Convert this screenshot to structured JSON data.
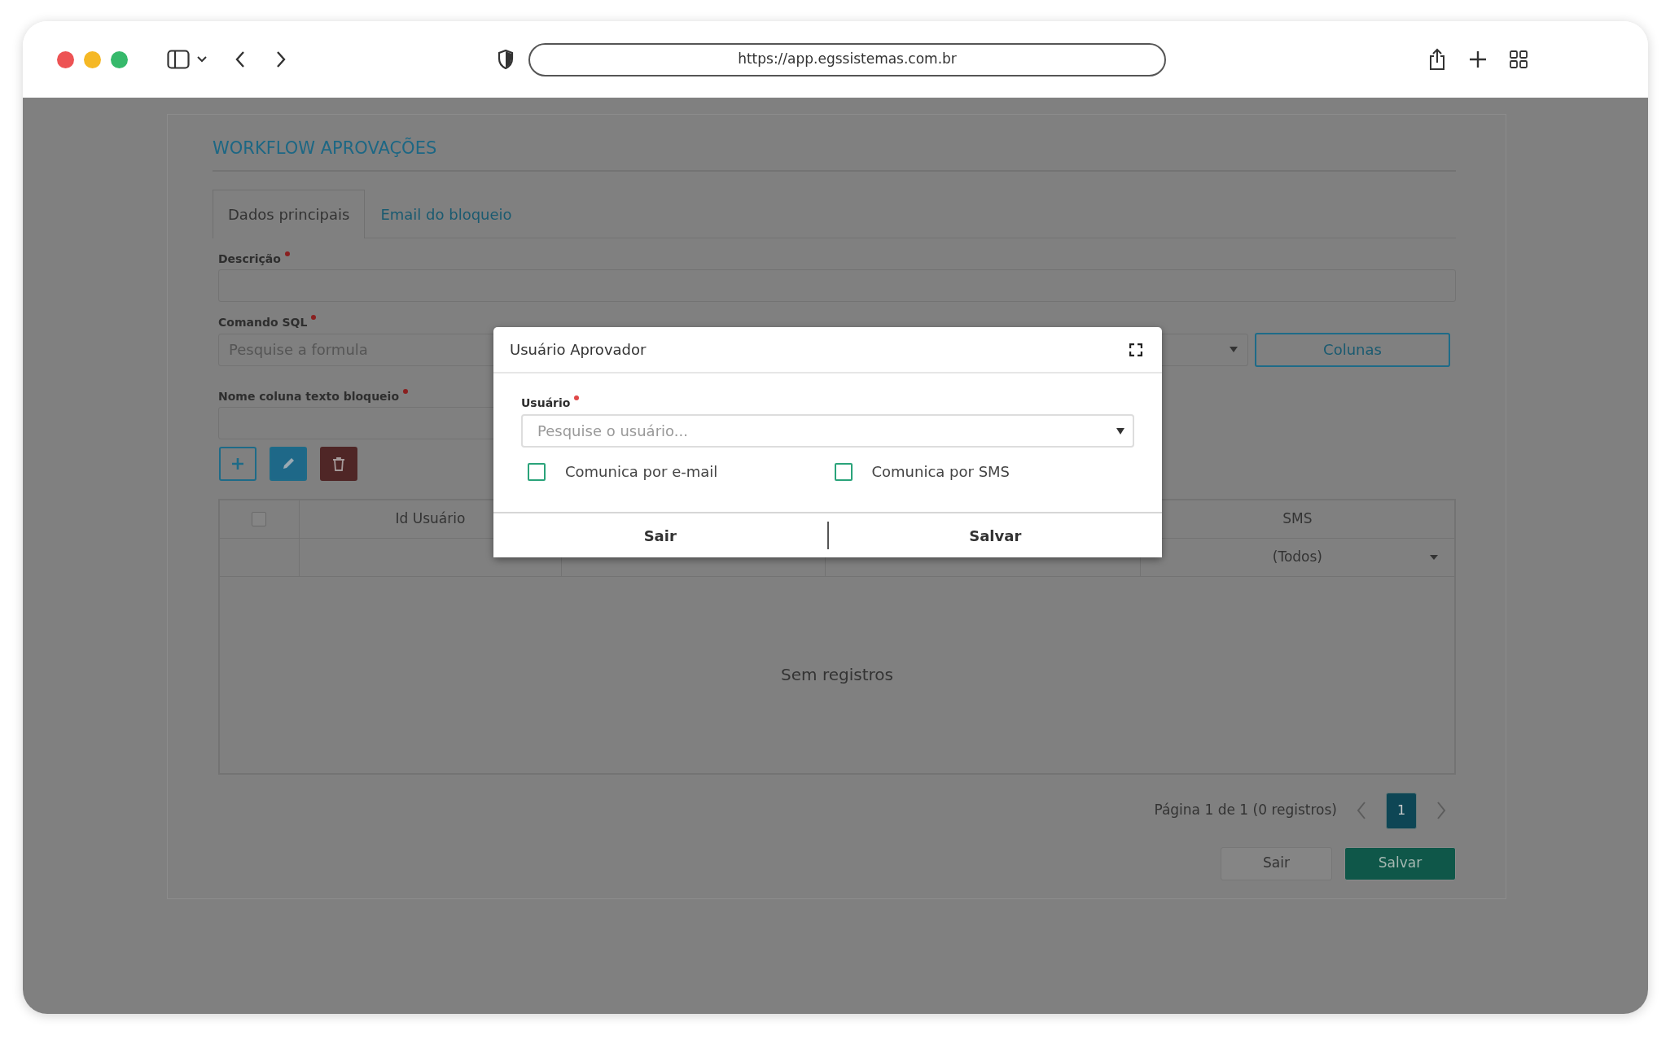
{
  "browser": {
    "url": "https://app.egssistemas.com.br"
  },
  "form": {
    "title": "WORKFLOW APROVAÇÕES",
    "tabs": [
      {
        "label": "Dados principais",
        "selected": true
      },
      {
        "label": "Email do bloqueio",
        "selected": false
      }
    ],
    "fields": [
      {
        "label": "Descrição",
        "required": true,
        "kind": "text"
      },
      {
        "label": "Comando SQL",
        "required": true,
        "kind": "select",
        "placeholder": "Pesquise a formula",
        "button": "Colunas"
      },
      {
        "label": "Nome coluna texto bloqueio",
        "required": true,
        "kind": "text"
      }
    ],
    "toolbar": [
      {
        "kind": "add"
      },
      {
        "kind": "edit"
      },
      {
        "kind": "delete"
      }
    ]
  },
  "table": {
    "columns": [
      {
        "kind": "select-all",
        "checked": false
      },
      {
        "kind": "label",
        "label": "Id Usuário"
      },
      {
        "kind": "covered"
      },
      {
        "kind": "covered"
      },
      {
        "kind": "label",
        "label": "SMS",
        "filter": "(Todos)"
      }
    ],
    "empty_text": "Sem registros"
  },
  "pagination": {
    "summary": "Página 1 de 1 (0 registros)",
    "pages": [
      {
        "label": "1",
        "selected": true
      }
    ]
  },
  "actions": [
    {
      "label": "Sair",
      "kind": "secondary"
    },
    {
      "label": "Salvar",
      "kind": "primary"
    }
  ],
  "modal": {
    "title": "Usuário Aprovador",
    "field": {
      "label": "Usuário",
      "required": true,
      "placeholder": "Pesquise o usuário..."
    },
    "checkboxes": [
      {
        "label": "Comunica por e-mail",
        "checked": false
      },
      {
        "label": "Comunica por SMS",
        "checked": false
      }
    ],
    "buttons": [
      "Sair",
      "Salvar"
    ]
  }
}
